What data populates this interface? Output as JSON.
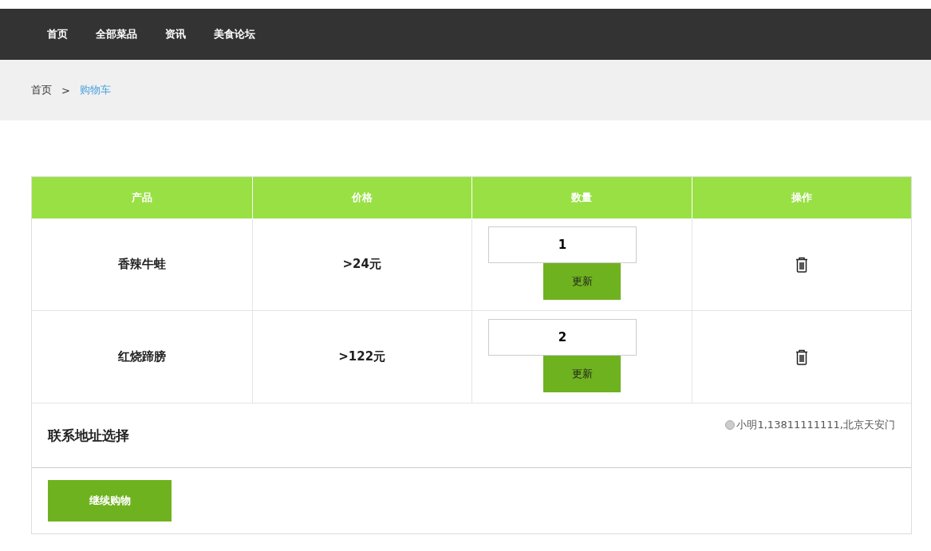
{
  "nav": [
    {
      "label": "首页"
    },
    {
      "label": "全部菜品"
    },
    {
      "label": "资讯"
    },
    {
      "label": "美食论坛"
    }
  ],
  "breadcrumb": [
    {
      "label": "首页",
      "selected": false
    },
    {
      "label": "购物车",
      "selected": true
    }
  ],
  "breadcrumb_separator": ">",
  "table": {
    "columns": [
      "产品",
      "价格",
      "数量",
      "操作"
    ],
    "rows": [
      {
        "product": "香辣牛蛙",
        "price": ">24元",
        "quantity": "1",
        "update": "更新"
      },
      {
        "product": "红烧蹄膀",
        "price": ">122元",
        "quantity": "2",
        "update": "更新"
      }
    ]
  },
  "address": {
    "title": "联系地址选择",
    "options": [
      {
        "label": "小明1,13811111111,北京天安门",
        "selected": false
      }
    ]
  },
  "continue_button": "继续购物"
}
